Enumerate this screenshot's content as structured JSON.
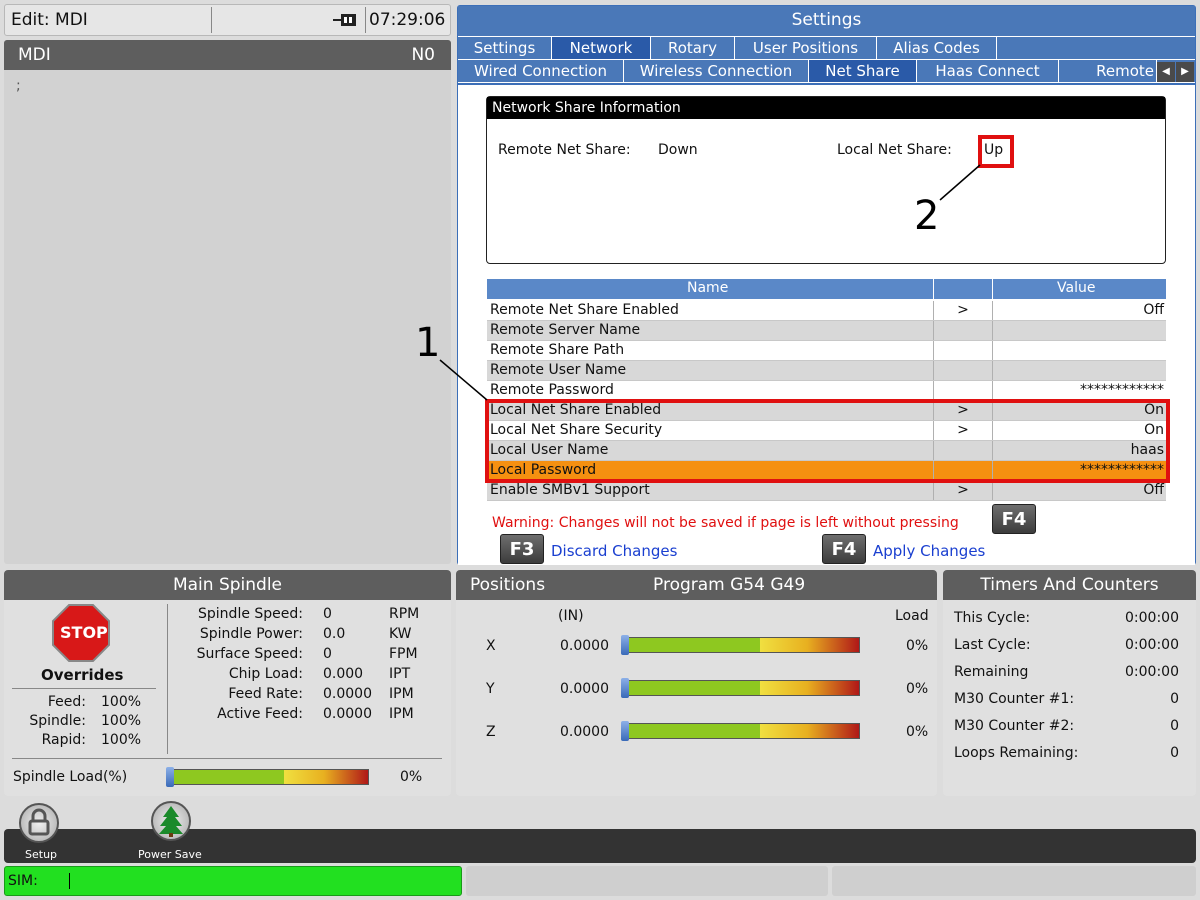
{
  "topbar": {
    "mode": "Edit: MDI",
    "time": "07:29:06"
  },
  "mdi": {
    "title": "MDI",
    "n_label": "N0",
    "cursor": ";"
  },
  "settings": {
    "title": "Settings",
    "tabs_row1": [
      "Settings",
      "Network",
      "Rotary",
      "User Positions",
      "Alias Codes"
    ],
    "tabs_row2": [
      "Wired Connection",
      "Wireless Connection",
      "Net Share",
      "Haas Connect",
      "Remote"
    ],
    "info": {
      "header": "Network Share Information",
      "remote_label": "Remote Net Share:",
      "remote_value": "Down",
      "local_label": "Local Net Share:",
      "local_value": "Up"
    },
    "table": {
      "col_name": "Name",
      "col_value": "Value",
      "rows": [
        {
          "name": "Remote Net Share Enabled",
          "arrow": ">",
          "value": "Off"
        },
        {
          "name": "Remote Server Name",
          "arrow": "",
          "value": ""
        },
        {
          "name": "Remote Share Path",
          "arrow": "",
          "value": ""
        },
        {
          "name": "Remote User Name",
          "arrow": "",
          "value": ""
        },
        {
          "name": "Remote Password",
          "arrow": "",
          "value": "************"
        },
        {
          "name": "Local Net Share Enabled",
          "arrow": ">",
          "value": "On"
        },
        {
          "name": "Local Net Share Security",
          "arrow": ">",
          "value": "On"
        },
        {
          "name": "Local User Name",
          "arrow": "",
          "value": "haas"
        },
        {
          "name": "Local Password",
          "arrow": "",
          "value": "************"
        },
        {
          "name": "Enable SMBv1 Support",
          "arrow": ">",
          "value": "Off"
        }
      ]
    },
    "warning": "Warning: Changes will not be saved if page is left without pressing",
    "f4_key": "F4",
    "f3_key": "F3",
    "discard_label": "Discard Changes",
    "apply_label": "Apply Changes"
  },
  "callouts": {
    "one": "1",
    "two": "2"
  },
  "spindle": {
    "title": "Main Spindle",
    "stop_label": "STOP",
    "overrides_title": "Overrides",
    "overrides": [
      {
        "label": "Feed:",
        "value": "100%"
      },
      {
        "label": "Spindle:",
        "value": "100%"
      },
      {
        "label": "Rapid:",
        "value": "100%"
      }
    ],
    "stats": [
      {
        "label": "Spindle Speed:",
        "value": "0",
        "unit": "RPM"
      },
      {
        "label": "Spindle Power:",
        "value": "0.0",
        "unit": "KW"
      },
      {
        "label": "Surface Speed:",
        "value": "0",
        "unit": "FPM"
      },
      {
        "label": "Chip Load:",
        "value": "0.000",
        "unit": "IPT"
      },
      {
        "label": "Feed Rate:",
        "value": "0.0000",
        "unit": "IPM"
      },
      {
        "label": "Active Feed:",
        "value": "0.0000",
        "unit": "IPM"
      }
    ],
    "load_label": "Spindle Load(%)",
    "load_value": "0%",
    "load_fraction": 0
  },
  "positions": {
    "title": "Positions",
    "program": "Program G54 G49",
    "unit": "(IN)",
    "load_header": "Load",
    "axes": [
      {
        "axis": "X",
        "value": "0.0000",
        "load": "0%"
      },
      {
        "axis": "Y",
        "value": "0.0000",
        "load": "0%"
      },
      {
        "axis": "Z",
        "value": "0.0000",
        "load": "0%"
      }
    ]
  },
  "timers": {
    "title": "Timers And Counters",
    "rows": [
      {
        "label": "This Cycle:",
        "value": "0:00:00"
      },
      {
        "label": "Last Cycle:",
        "value": "0:00:00"
      },
      {
        "label": "Remaining",
        "value": "0:00:00"
      },
      {
        "label": "M30 Counter #1:",
        "value": "0"
      },
      {
        "label": "M30 Counter #2:",
        "value": "0"
      },
      {
        "label": "Loops Remaining:",
        "value": "0"
      }
    ]
  },
  "toolbar": {
    "setup_label": "Setup",
    "power_save_label": "Power Save"
  },
  "statusbar": {
    "sim_label": "SIM:"
  }
}
